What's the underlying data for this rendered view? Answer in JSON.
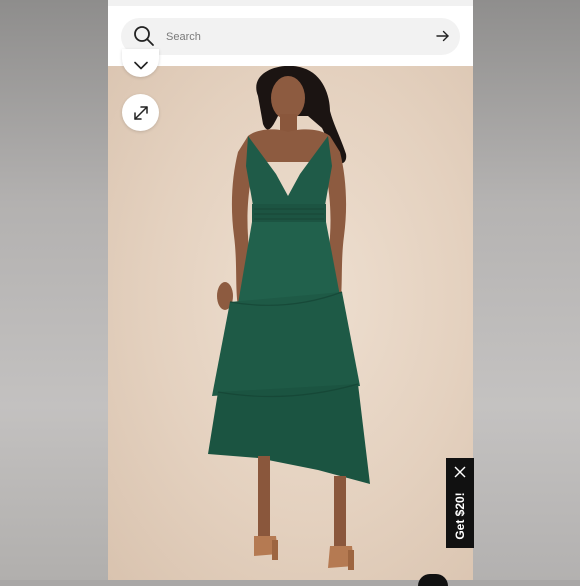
{
  "search": {
    "placeholder": "Search"
  },
  "promo": {
    "label": "Get $20!"
  },
  "icons": {
    "search": "magnifier-icon",
    "submit": "arrow-right-icon",
    "collapse": "chevron-down-icon",
    "expand": "expand-arrows-icon",
    "close": "close-icon"
  },
  "colors": {
    "dress": "#1f5b48",
    "backdrop": "#e6d6c6",
    "promo_bg": "#111111"
  }
}
